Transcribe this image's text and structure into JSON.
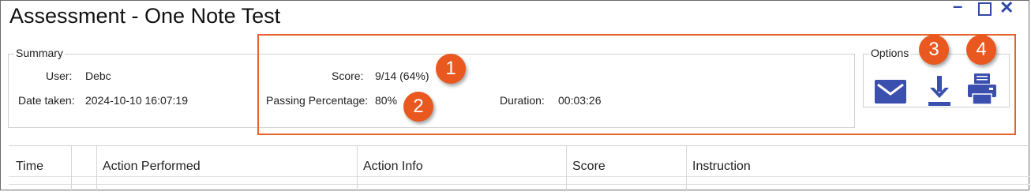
{
  "window": {
    "title": "Assessment - One Note Test",
    "minimize": "–",
    "close": "✕"
  },
  "summary": {
    "legend": "Summary",
    "user_label": "User:",
    "user_value": "Debc",
    "date_label": "Date taken:",
    "date_value": "2024-10-10 16:07:19",
    "score_label": "Score:",
    "score_value": "9/14 (64%)",
    "passing_label": "Passing Percentage:",
    "passing_value": "80%",
    "duration_label": "Duration:",
    "duration_value": "00:03:26"
  },
  "options": {
    "legend": "Options",
    "email_icon": "envelope-icon",
    "download_icon": "download-icon",
    "print_icon": "printer-icon",
    "icon_color": "#3a4fae"
  },
  "callouts": {
    "color": "#e9581f",
    "items": [
      "1",
      "2",
      "3",
      "4"
    ]
  },
  "table": {
    "columns": [
      "Time",
      "",
      "Action Performed",
      "Action Info",
      "Score",
      "Instruction"
    ]
  }
}
